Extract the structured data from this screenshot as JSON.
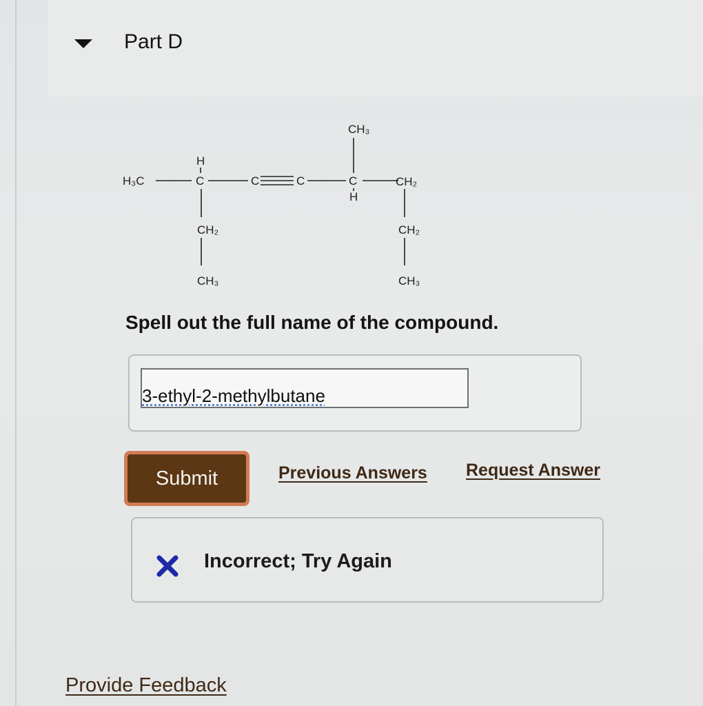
{
  "part": {
    "title": "Part D"
  },
  "structure": {
    "labels": {
      "h3c": "H₃C",
      "h_top": "H",
      "c1": "C",
      "c_triple_left": "C",
      "c_triple_right": "C",
      "c2": "C",
      "ch3_top": "CH₃",
      "ch2_right": "CH₂",
      "h_bottom": "H",
      "ch2_left": "CH₂",
      "ch3_left": "CH₃",
      "ch2_right_lower": "CH₂",
      "ch3_right": "CH₃"
    }
  },
  "question": {
    "text": "Spell out the full name of the compound."
  },
  "answer": {
    "value": "3-ethyl-2-methylbutane"
  },
  "actions": {
    "submit_label": "Submit",
    "previous_answers_label": "Previous Answers",
    "request_answer_label": "Request Answer"
  },
  "feedback": {
    "status_icon": "x-icon",
    "message": "Incorrect; Try Again"
  },
  "footer": {
    "provide_feedback_label": "Provide Feedback"
  },
  "colors": {
    "submit_bg": "#5c3714",
    "submit_border": "#d27c55",
    "link": "#3f2916",
    "incorrect_icon": "#1c2aa8"
  }
}
